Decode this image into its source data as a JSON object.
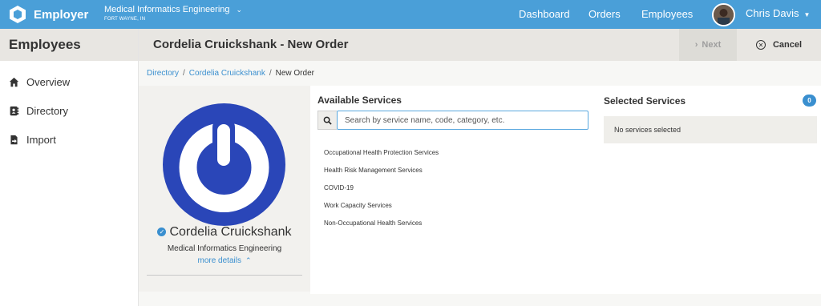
{
  "app": {
    "brand_name": "Employer"
  },
  "org": {
    "name": "Medical Informatics Engineering",
    "location": "FORT WAYNE, IN"
  },
  "nav": {
    "items": [
      "Dashboard",
      "Orders",
      "Employees"
    ]
  },
  "user": {
    "name": "Chris Davis"
  },
  "sidebar": {
    "title": "Employees",
    "items": [
      {
        "label": "Overview",
        "icon": "home-icon"
      },
      {
        "label": "Directory",
        "icon": "address-book-icon"
      },
      {
        "label": "Import",
        "icon": "file-import-icon"
      }
    ]
  },
  "header": {
    "title": "Cordelia Cruickshank - New Order",
    "next_label": "Next",
    "cancel_label": "Cancel"
  },
  "breadcrumb": {
    "items": [
      "Directory",
      "Cordelia Cruickshank",
      "New Order"
    ]
  },
  "profile": {
    "name": "Cordelia Cruickshank",
    "organization": "Medical Informatics Engineering",
    "more_label": "more details"
  },
  "available": {
    "title": "Available Services",
    "search_placeholder": "Search by service name, code, category, etc.",
    "services": [
      "Occupational Health Protection Services",
      "Health Risk Management Services",
      "COVID-19",
      "Work Capacity Services",
      "Non-Occupational Health Services"
    ]
  },
  "selected": {
    "title": "Selected Services",
    "count": "0",
    "empty_text": "No services selected"
  },
  "colors": {
    "topbar": "#4a9fd8",
    "accent": "#3a8fcf",
    "logo_blue": "#2a46b8"
  }
}
